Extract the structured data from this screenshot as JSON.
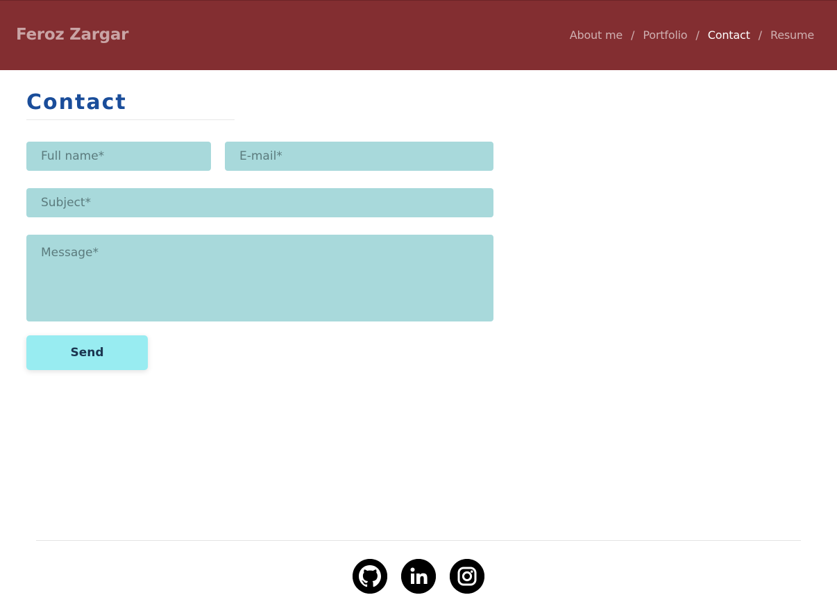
{
  "header": {
    "brand": "Feroz Zargar",
    "nav": [
      {
        "label": "About me",
        "active": false
      },
      {
        "label": "Portfolio",
        "active": false
      },
      {
        "label": "Contact",
        "active": true
      },
      {
        "label": "Resume",
        "active": false
      }
    ],
    "separator": "/"
  },
  "main": {
    "title": "Contact",
    "form": {
      "name_placeholder": "Full name*",
      "email_placeholder": "E-mail*",
      "subject_placeholder": "Subject*",
      "message_placeholder": "Message*",
      "send_label": "Send"
    }
  },
  "footer": {
    "socials": [
      {
        "icon": "github-icon"
      },
      {
        "icon": "linkedin-icon"
      },
      {
        "icon": "instagram-icon"
      }
    ]
  },
  "colors": {
    "header_bg": "#832e31",
    "title": "#1a4d9a",
    "field_bg": "#a8d9db",
    "button_bg": "#98ecf1"
  }
}
